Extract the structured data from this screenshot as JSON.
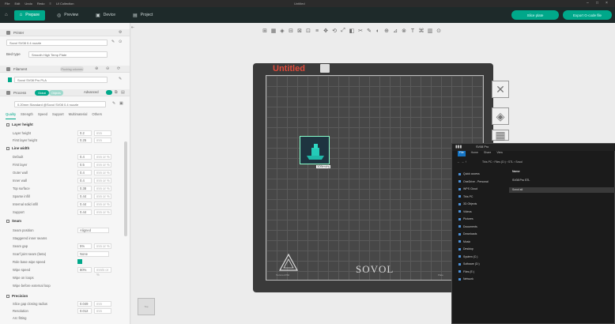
{
  "titlebar": {
    "items": [
      "File",
      "Edit",
      "Undo",
      "Redo",
      "≡",
      "UI Collection"
    ],
    "title": "Untitled"
  },
  "tabs": [
    {
      "label": "Prepare",
      "icon": "⌂",
      "active": true
    },
    {
      "label": "Preview",
      "icon": "◎",
      "active": false
    },
    {
      "label": "Device",
      "icon": "▣",
      "active": false
    },
    {
      "label": "Project",
      "icon": "▤",
      "active": false
    }
  ],
  "actions": {
    "slice": "Slice plate",
    "export": "Export G-code file"
  },
  "printer": {
    "header": "Printer",
    "model": "Sovol SV08 0.4 nozzle",
    "bed_type_label": "Bed type",
    "bed_type": "Smooth High Temp Plate"
  },
  "filament": {
    "header": "Filament",
    "edit": "Flushing volumes",
    "selected": "Sovol SV08 Pro PLA"
  },
  "process": {
    "header": "Process",
    "mode_global": "Global",
    "mode_objects": "Objects",
    "advanced_label": "Advanced",
    "preset": "0.20mm Standard @Sovol SV08 0.4 nozzle"
  },
  "subtabs": [
    "Quality",
    "Strength",
    "Speed",
    "Support",
    "Multimaterial",
    "Others"
  ],
  "sections": {
    "layer_height": {
      "title": "Layer height",
      "params": [
        {
          "label": "Layer height",
          "value": "0.2",
          "unit": "mm"
        },
        {
          "label": "First layer height",
          "value": "0.25",
          "unit": "mm"
        }
      ]
    },
    "line_width": {
      "title": "Line width",
      "params": [
        {
          "label": "Default",
          "value": "0.4",
          "unit": "mm or %"
        },
        {
          "label": "First layer",
          "value": "0.5",
          "unit": "mm or %"
        },
        {
          "label": "Outer wall",
          "value": "0.4",
          "unit": "mm or %"
        },
        {
          "label": "Inner wall",
          "value": "0.4",
          "unit": "mm or %"
        },
        {
          "label": "Top surface",
          "value": "0.38",
          "unit": "mm or %"
        },
        {
          "label": "Sparse infill",
          "value": "0.44",
          "unit": "mm or %"
        },
        {
          "label": "Internal solid infill",
          "value": "0.44",
          "unit": "mm or %"
        },
        {
          "label": "Support",
          "value": "0.44",
          "unit": "mm or %"
        }
      ]
    },
    "seam": {
      "title": "Seam",
      "params": [
        {
          "label": "Seam position",
          "wide": "Aligned"
        },
        {
          "label": "Staggered inner seams",
          "none": true
        },
        {
          "label": "Seam gap",
          "value": "5%",
          "unit": "mm or %"
        },
        {
          "label": "Scarf joint seam (beta)",
          "wide": "None"
        },
        {
          "label": "Role base wipe speed",
          "check": true
        },
        {
          "label": "Wipe speed",
          "value": "80%",
          "unit": "mm/s or %"
        },
        {
          "label": "Wipe on loops",
          "none": true
        },
        {
          "label": "Wipe before external loop",
          "none": true
        }
      ]
    },
    "precision": {
      "title": "Precision",
      "params": [
        {
          "label": "Slice gap closing radius",
          "value": "0.049",
          "unit": "mm"
        },
        {
          "label": "Resolution",
          "value": "0.012",
          "unit": "mm"
        },
        {
          "label": "Arc fitting",
          "none": true
        }
      ]
    }
  },
  "plate": {
    "title": "Untitled",
    "brand": "SOVOL",
    "small_left": "Textured PEI",
    "small_right": "Plate",
    "model_label": "3DBenchy"
  },
  "gizmo": {
    "label": "Top"
  },
  "explorer": {
    "title": "SV08 Pro",
    "tabs": [
      {
        "label": "File",
        "active": true
      },
      {
        "label": "Home",
        "active": false
      },
      {
        "label": "Share",
        "active": false
      },
      {
        "label": "View",
        "active": false
      }
    ],
    "address": "This PC  ›  Files (D:)  ›  STL  ›  Sovol",
    "nav": [
      "Quick access",
      "OneDrive - Personal",
      "WPS Cloud",
      "This PC",
      "3D Objects",
      "Videos",
      "Pictures",
      "Documents",
      "Downloads",
      "Music",
      "Desktop",
      "System (C:)",
      "Software (D:)",
      "Files (E:)",
      "Network"
    ],
    "list_header": "Name",
    "files": [
      "SV08 Pro STL",
      "Sovol.stl"
    ]
  },
  "colors": {
    "accent": "#00a88a",
    "plate_title": "#e04a3a",
    "explorer_select": "#1574c4"
  }
}
